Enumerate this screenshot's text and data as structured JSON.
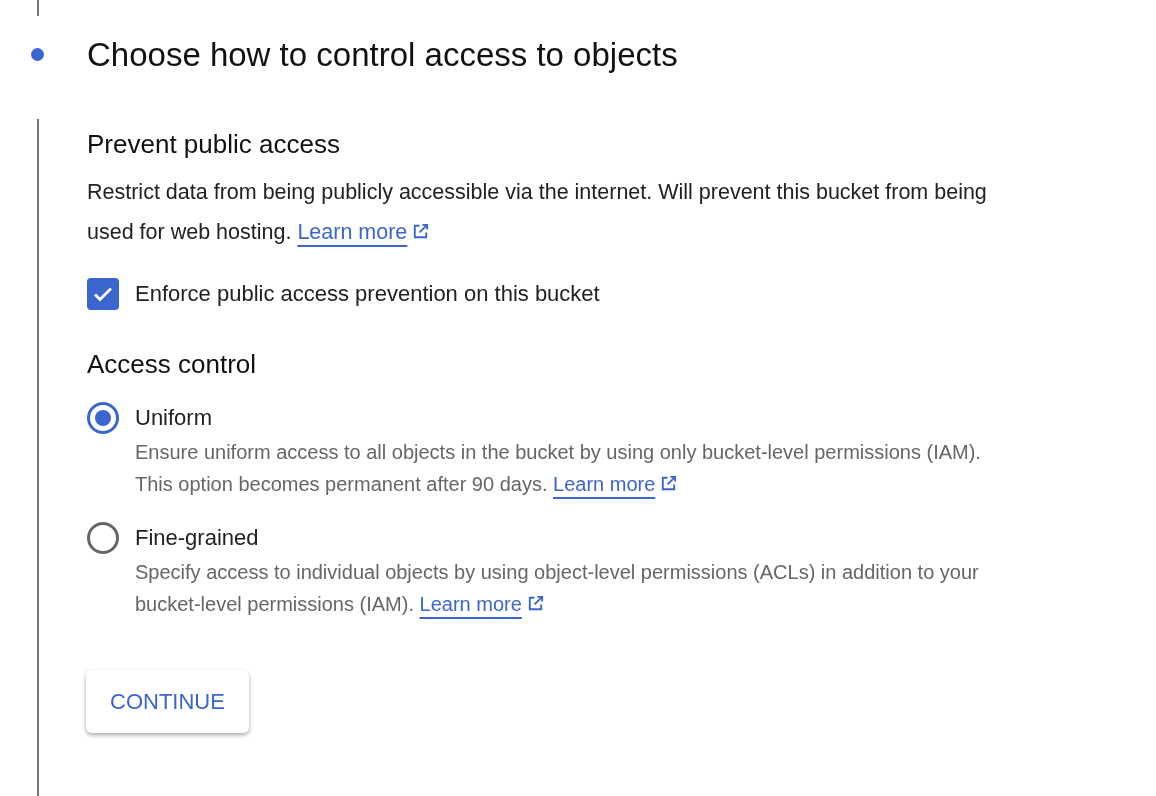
{
  "step": {
    "title": "Choose how to control access to objects",
    "active": true
  },
  "public_access": {
    "heading": "Prevent public access",
    "description": "Restrict data from being publicly accessible via the internet. Will prevent this bucket from being used for web hosting.",
    "link": "Learn more",
    "checkbox": {
      "label": "Enforce public access prevention on this bucket",
      "checked": true
    }
  },
  "access_control": {
    "heading": "Access control",
    "options": [
      {
        "label": "Uniform",
        "description": "Ensure uniform access to all objects in the bucket by using only bucket-level permissions (IAM). This option becomes permanent after 90 days.",
        "link": "Learn more",
        "selected": true
      },
      {
        "label": "Fine-grained",
        "description": "Specify access to individual objects by using object-level permissions (ACLs) in addition to your bucket-level permissions (IAM).",
        "link": "Learn more",
        "selected": false
      }
    ]
  },
  "button": "CONTINUE"
}
